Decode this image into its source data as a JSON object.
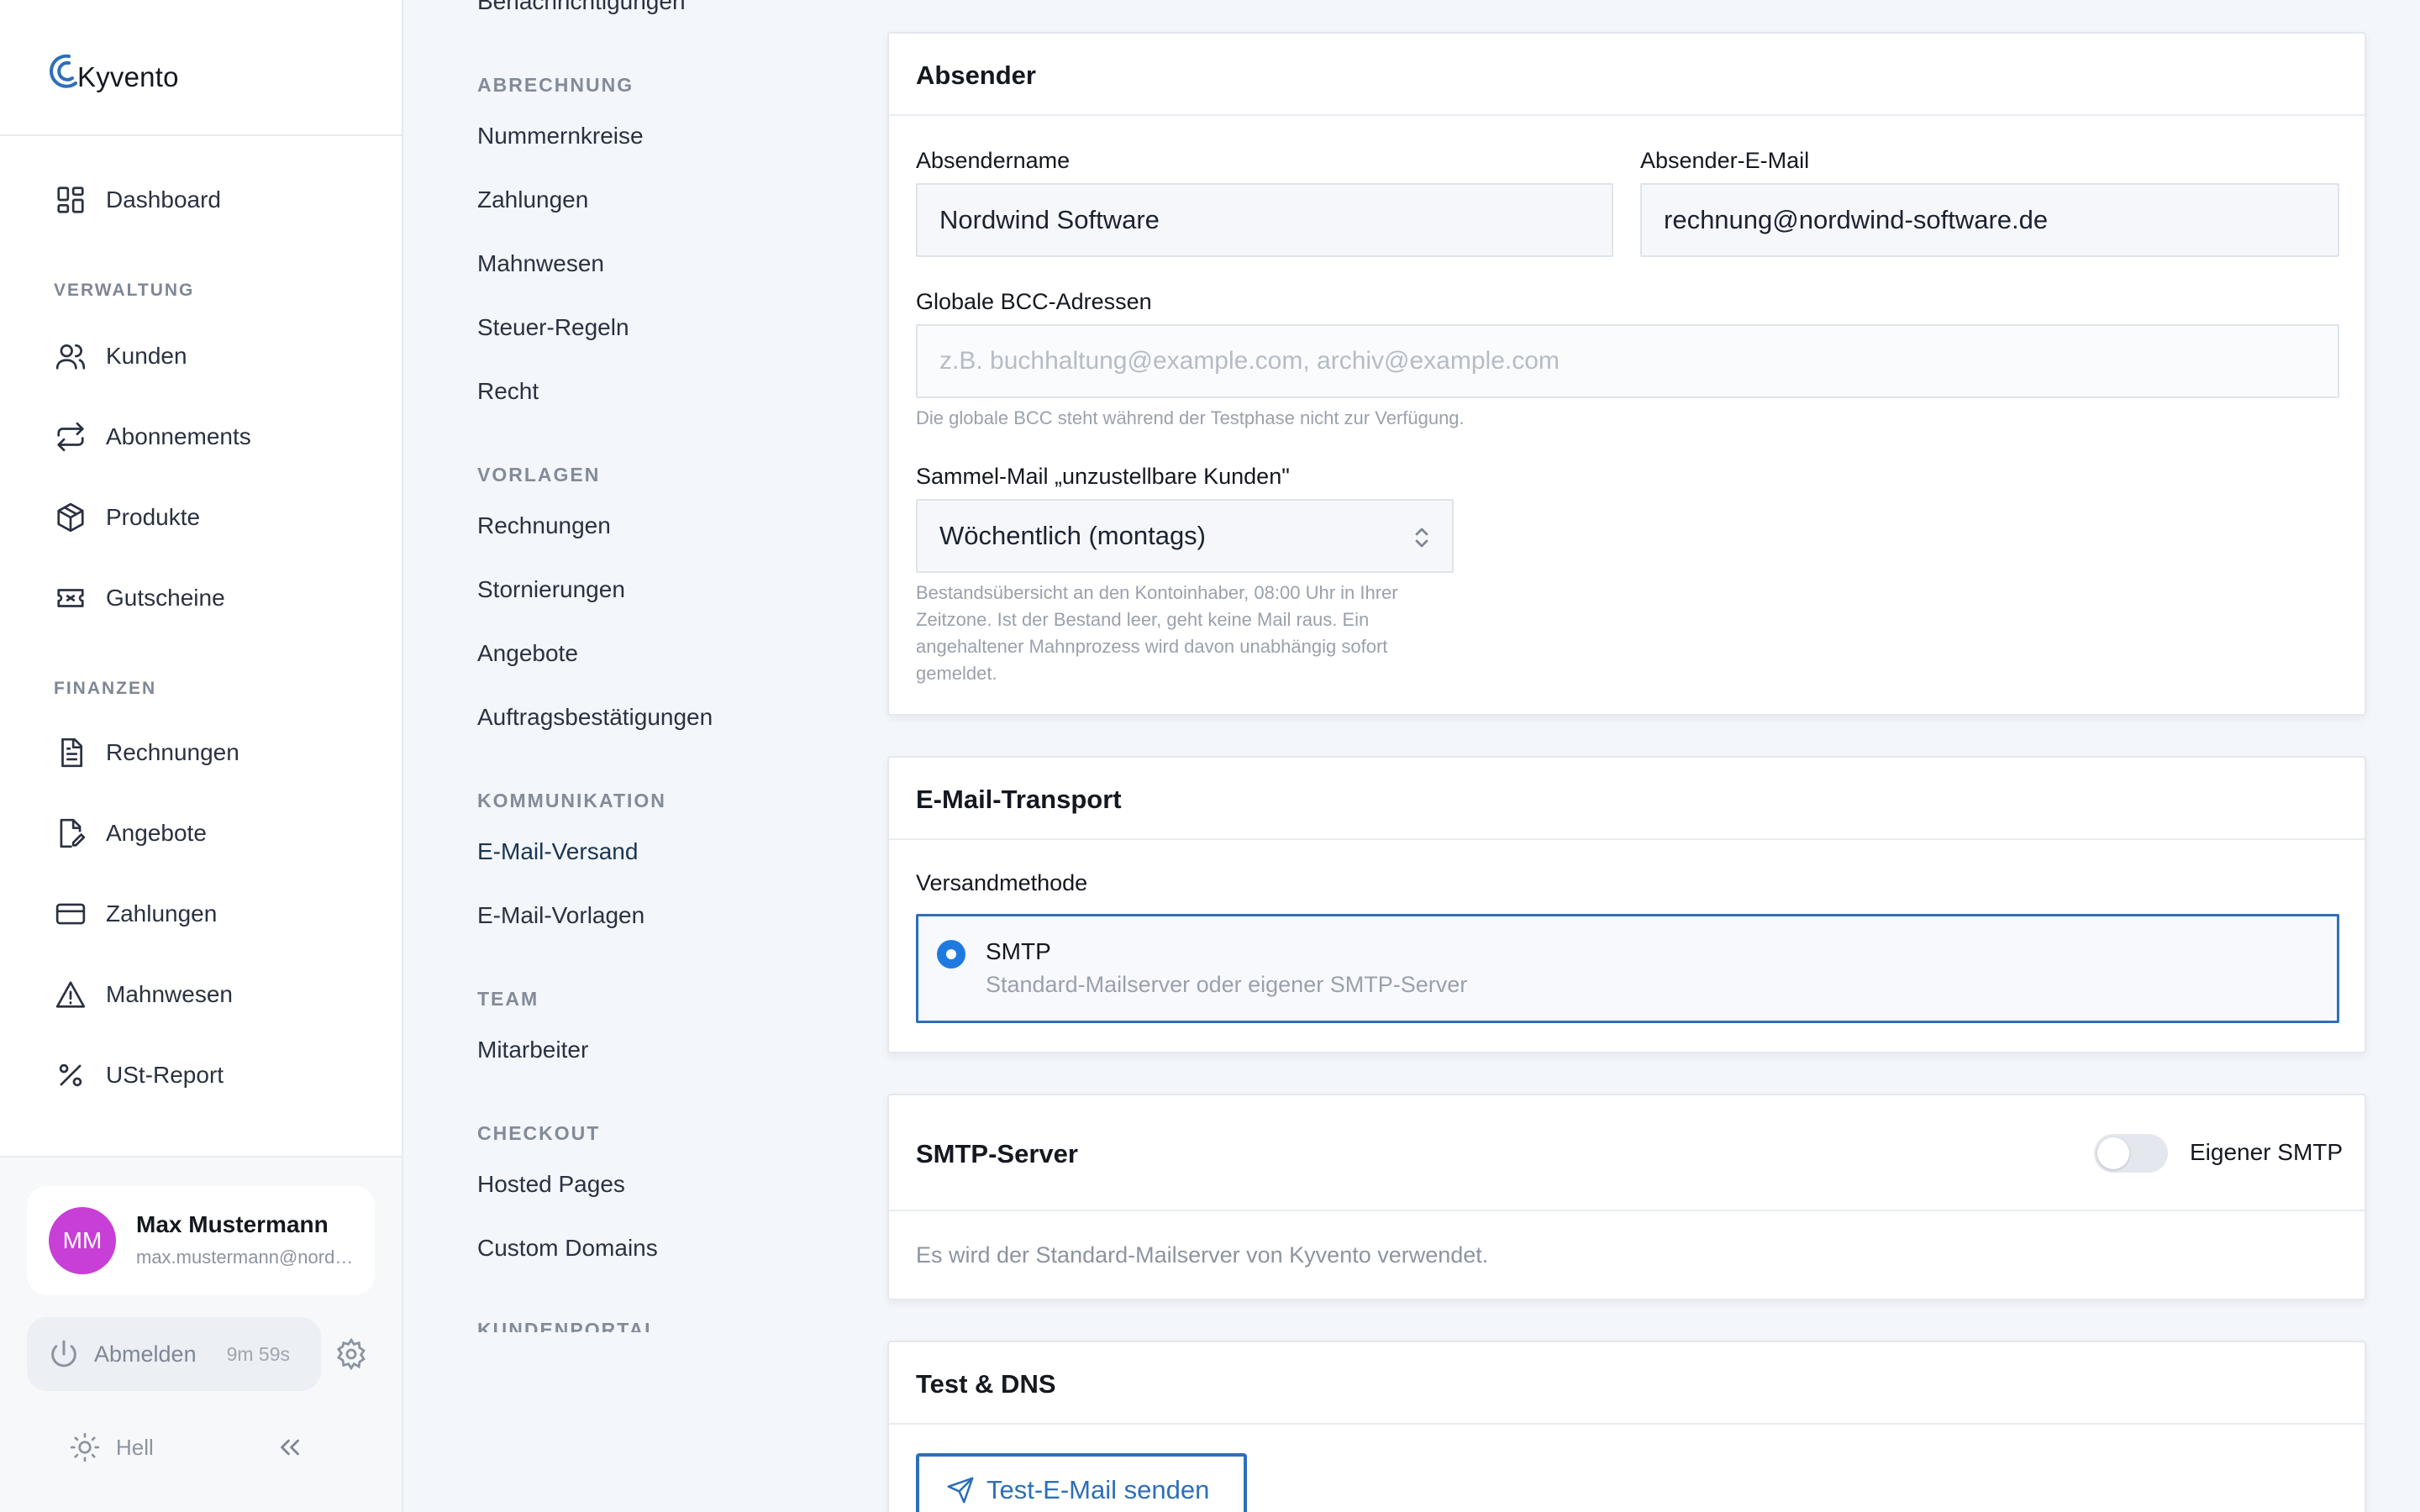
{
  "brand": {
    "name": "Kyvento",
    "accent": "#2d6fb8"
  },
  "sidebar": {
    "items_main": [
      {
        "label": "Dashboard",
        "icon": "dashboard-icon"
      }
    ],
    "sections": [
      {
        "title": "VERWALTUNG",
        "items": [
          {
            "label": "Kunden",
            "icon": "users-icon"
          },
          {
            "label": "Abonnements",
            "icon": "repeat-icon"
          },
          {
            "label": "Produkte",
            "icon": "box-icon"
          },
          {
            "label": "Gutscheine",
            "icon": "ticket-icon"
          }
        ]
      },
      {
        "title": "FINANZEN",
        "items": [
          {
            "label": "Rechnungen",
            "icon": "document-icon"
          },
          {
            "label": "Angebote",
            "icon": "document-edit-icon"
          },
          {
            "label": "Zahlungen",
            "icon": "credit-card-icon"
          },
          {
            "label": "Mahnwesen",
            "icon": "warning-icon"
          },
          {
            "label": "USt-Report",
            "icon": "percent-icon"
          }
        ]
      }
    ],
    "user": {
      "initials": "MM",
      "name": "Max Mustermann",
      "email": "max.mustermann@nordwind-software.de"
    },
    "logout": {
      "label": "Abmelden",
      "timer": "9m 59s"
    },
    "theme": {
      "label": "Hell"
    }
  },
  "settings_nav": {
    "top_cut_item": "Benachrichtigungen",
    "sections": [
      {
        "title": "ABRECHNUNG",
        "items": [
          "Nummernkreise",
          "Zahlungen",
          "Mahnwesen",
          "Steuer-Regeln",
          "Recht"
        ]
      },
      {
        "title": "VORLAGEN",
        "items": [
          "Rechnungen",
          "Stornierungen",
          "Angebote",
          "Auftragsbestätigungen"
        ]
      },
      {
        "title": "KOMMUNIKATION",
        "items": [
          "E-Mail-Versand",
          "E-Mail-Vorlagen"
        ]
      },
      {
        "title": "TEAM",
        "items": [
          "Mitarbeiter"
        ]
      },
      {
        "title": "CHECKOUT",
        "items": [
          "Hosted Pages",
          "Custom Domains"
        ]
      },
      {
        "title": "KUNDENPORTAL",
        "items": []
      }
    ],
    "active": "E-Mail-Versand"
  },
  "absender": {
    "title": "Absender",
    "name_label": "Absendername",
    "name_value": "Nordwind Software",
    "email_label": "Absender-E-Mail",
    "email_value": "rechnung@nordwind-software.de",
    "bcc_label": "Globale BCC-Adressen",
    "bcc_placeholder": "z.B. buchhaltung@example.com, archiv@example.com",
    "bcc_hint": "Die globale BCC steht während der Testphase nicht zur Verfügung.",
    "sammel_label": "Sammel-Mail „unzustellbare Kunden\"",
    "sammel_value": "Wöchentlich (montags)",
    "sammel_hint_lines": [
      "Bestandsübersicht an den Kontoinhaber, 08:00 Uhr in Ihrer",
      "Zeitzone. Ist der Bestand leer, geht keine Mail raus. Ein",
      "angehaltener Mahnprozess wird davon unabhängig sofort",
      "gemeldet."
    ]
  },
  "transport": {
    "title": "E-Mail-Transport",
    "method_label": "Versandmethode",
    "option_title": "SMTP",
    "option_desc": "Standard-Mailserver oder eigener SMTP-Server",
    "option_selected": true
  },
  "smtp": {
    "title": "SMTP-Server",
    "toggle_label": "Eigener SMTP",
    "toggle_on": false,
    "info": "Es wird der Standard-Mailserver von Kyvento verwendet."
  },
  "test_dns": {
    "title": "Test & DNS",
    "button_label": "Test-E-Mail senden"
  }
}
